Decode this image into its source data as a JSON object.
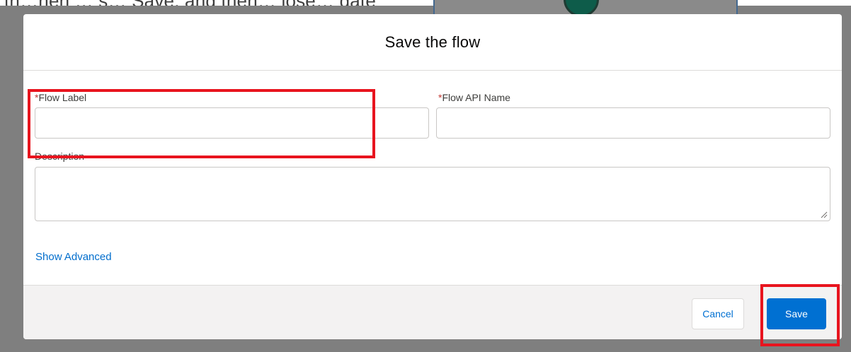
{
  "background": {
    "doc_text_fragment": "th…hen … s… Save, and then… lose… date"
  },
  "modal": {
    "title": "Save the flow",
    "fields": {
      "flow_label": {
        "required_mark": "*",
        "label": "Flow Label",
        "value": ""
      },
      "flow_api_name": {
        "required_mark": "*",
        "label": "Flow API Name",
        "value": ""
      },
      "description": {
        "label": "Description",
        "value": ""
      }
    },
    "show_advanced_link": "Show Advanced",
    "footer": {
      "cancel_label": "Cancel",
      "save_label": "Save"
    }
  },
  "colors": {
    "brand_blue": "#0070d2",
    "highlight_red": "#e8141e",
    "required_red": "#c23934",
    "overlay_gray": "#7f7f7f",
    "footer_gray": "#f3f2f2"
  }
}
